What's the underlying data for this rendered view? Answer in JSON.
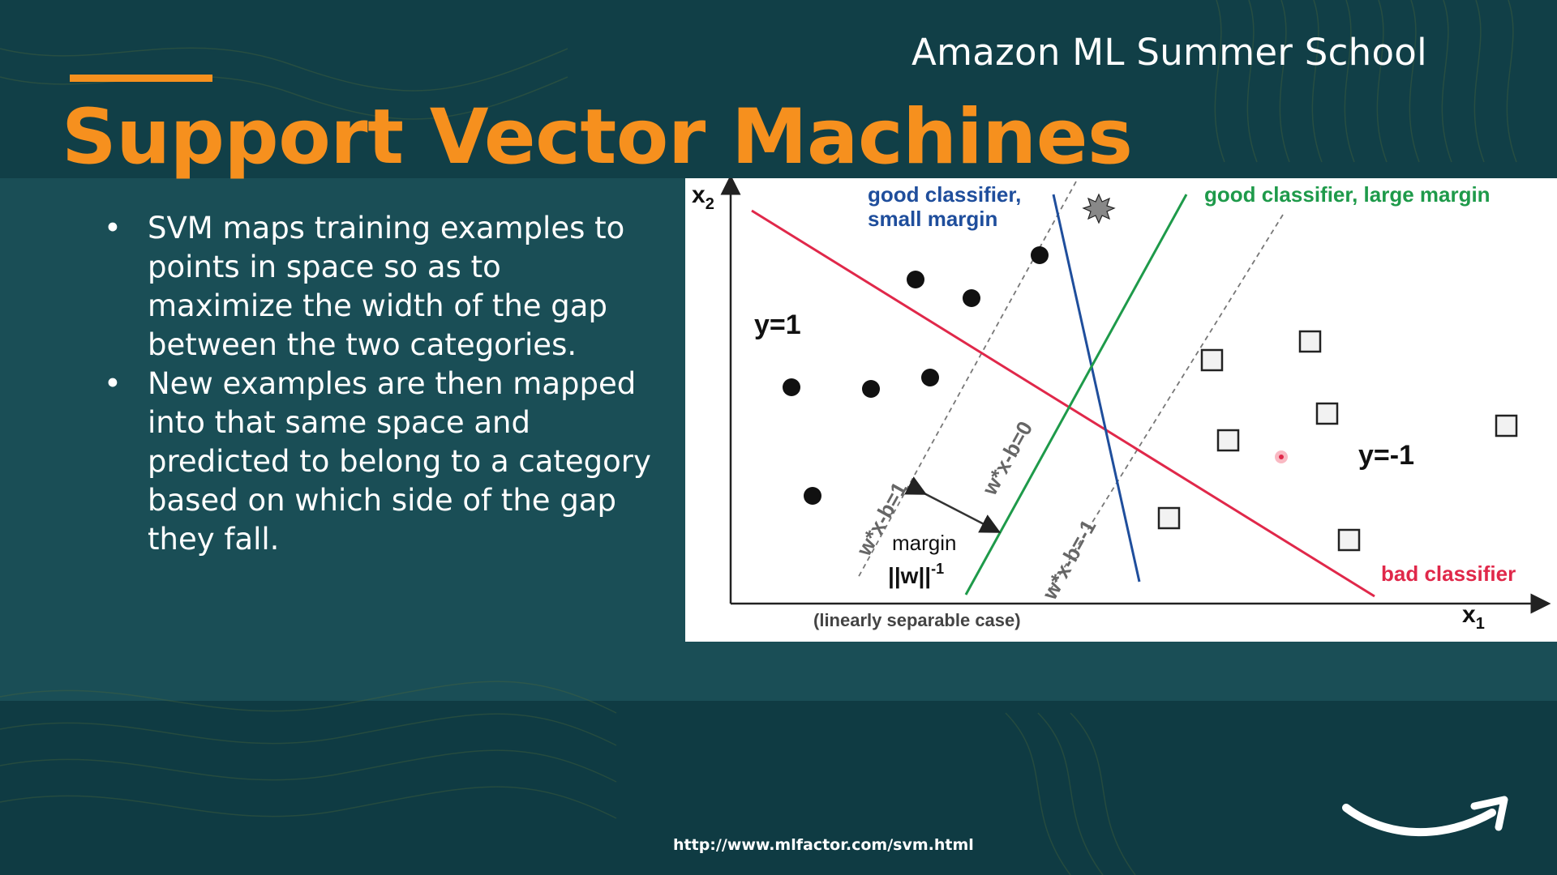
{
  "header": {
    "school": "Amazon ML Summer School",
    "title": "Support Vector Machines"
  },
  "bullets": [
    "SVM maps training examples to points in space so as to maximize the width of the gap between the two categories.",
    "New examples are then mapped into that same space and predicted to belong to a category based on which side of the gap they fall."
  ],
  "bullet_symbol": "•",
  "figure": {
    "axis_x": "x",
    "axis_x_sub": "1",
    "axis_y": "x",
    "axis_y_sub": "2",
    "label_good_small_1": "good classifier,",
    "label_good_small_2": "small margin",
    "label_good_large": "good classifier, large margin",
    "label_bad": "bad classifier",
    "class_pos": "y=1",
    "class_neg": "y=-1",
    "eq_plus": "w*x-b=1",
    "eq_zero": "w*x-b=0",
    "eq_minus": "w*x-b=-1",
    "margin_label": "margin",
    "margin_formula": "||w||",
    "margin_exp": "-1",
    "caption": "(linearly separable case)",
    "colors": {
      "good_small": "#1f4e9c",
      "good_large": "#1e9a4a",
      "bad": "#e0284a"
    }
  },
  "footer": {
    "source_url": "http://www.mlfactor.com/svm.html",
    "logo": "amazon-smile-icon"
  }
}
